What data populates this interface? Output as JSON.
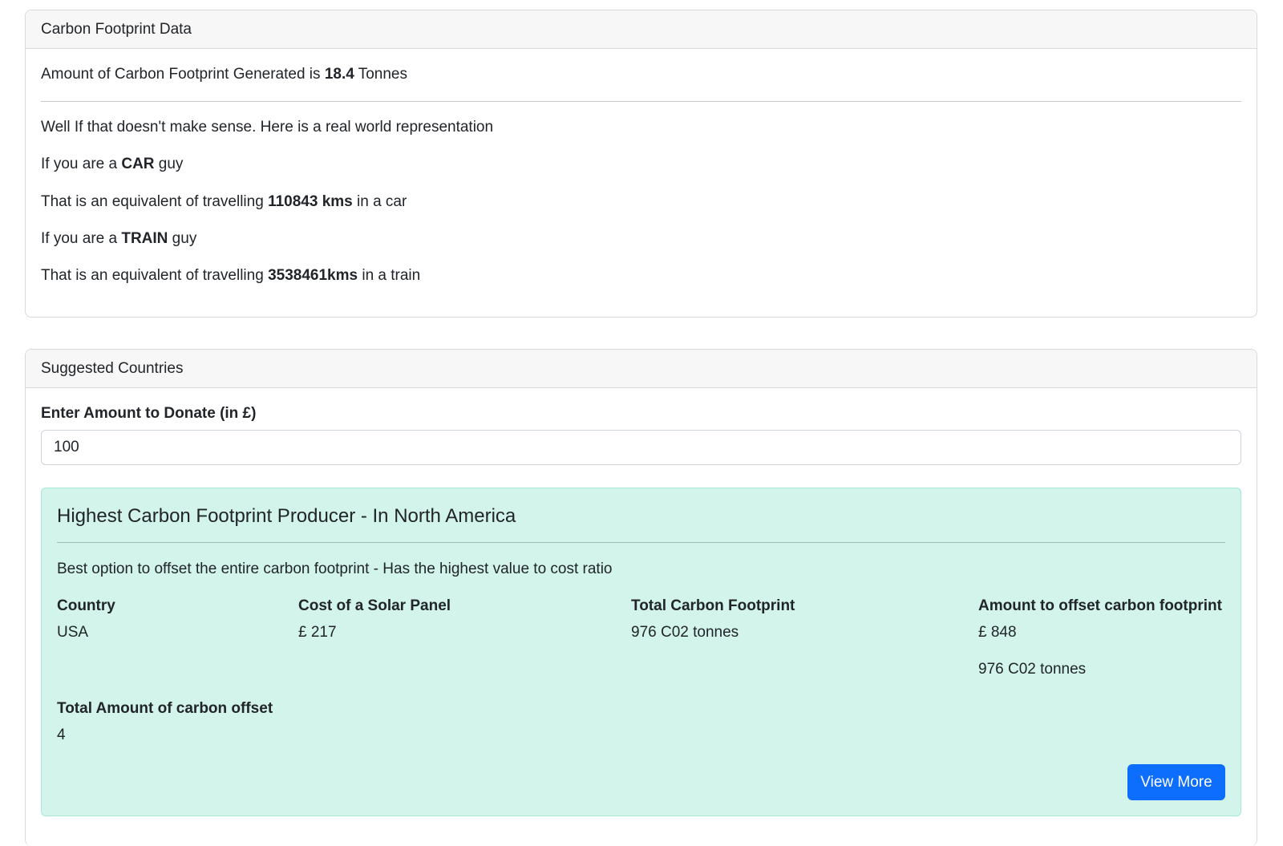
{
  "carbon_card": {
    "header": "Carbon Footprint Data",
    "generated_prefix": "Amount of Carbon Footprint Generated is ",
    "generated_value": "18.4",
    "generated_suffix": " Tonnes",
    "intro": "Well If that doesn't make sense. Here is a real world representation",
    "car_prefix": "If you are a ",
    "car_word": "CAR",
    "car_suffix": " guy",
    "car_equiv_prefix": "That is an equivalent of travelling ",
    "car_equiv_value": "110843 kms",
    "car_equiv_suffix": " in a car",
    "train_prefix": "If you are a ",
    "train_word": "TRAIN",
    "train_suffix": " guy",
    "train_equiv_prefix": "That is an equivalent of travelling ",
    "train_equiv_value": "3538461kms",
    "train_equiv_suffix": " in a train"
  },
  "countries_card": {
    "header": "Suggested Countries",
    "donate_label": "Enter Amount to Donate (in £)",
    "donate_value": "100",
    "result": {
      "heading": "Highest Carbon Footprint Producer - In North America",
      "subtitle": "Best option to offset the entire carbon footprint - Has the highest value to cost ratio",
      "col_country": "Country",
      "col_cost": "Cost of a Solar Panel",
      "col_total": "Total Carbon Footprint",
      "col_offset": "Amount to offset carbon footprint",
      "country": "USA",
      "cost": "£ 217",
      "total": "976 C02 tonnes",
      "offset_amount": "£ 848",
      "offset_tonnes": "976 C02 tonnes",
      "total_offset_label": "Total Amount of carbon offset",
      "total_offset_value": "4",
      "view_more": "View More"
    }
  }
}
